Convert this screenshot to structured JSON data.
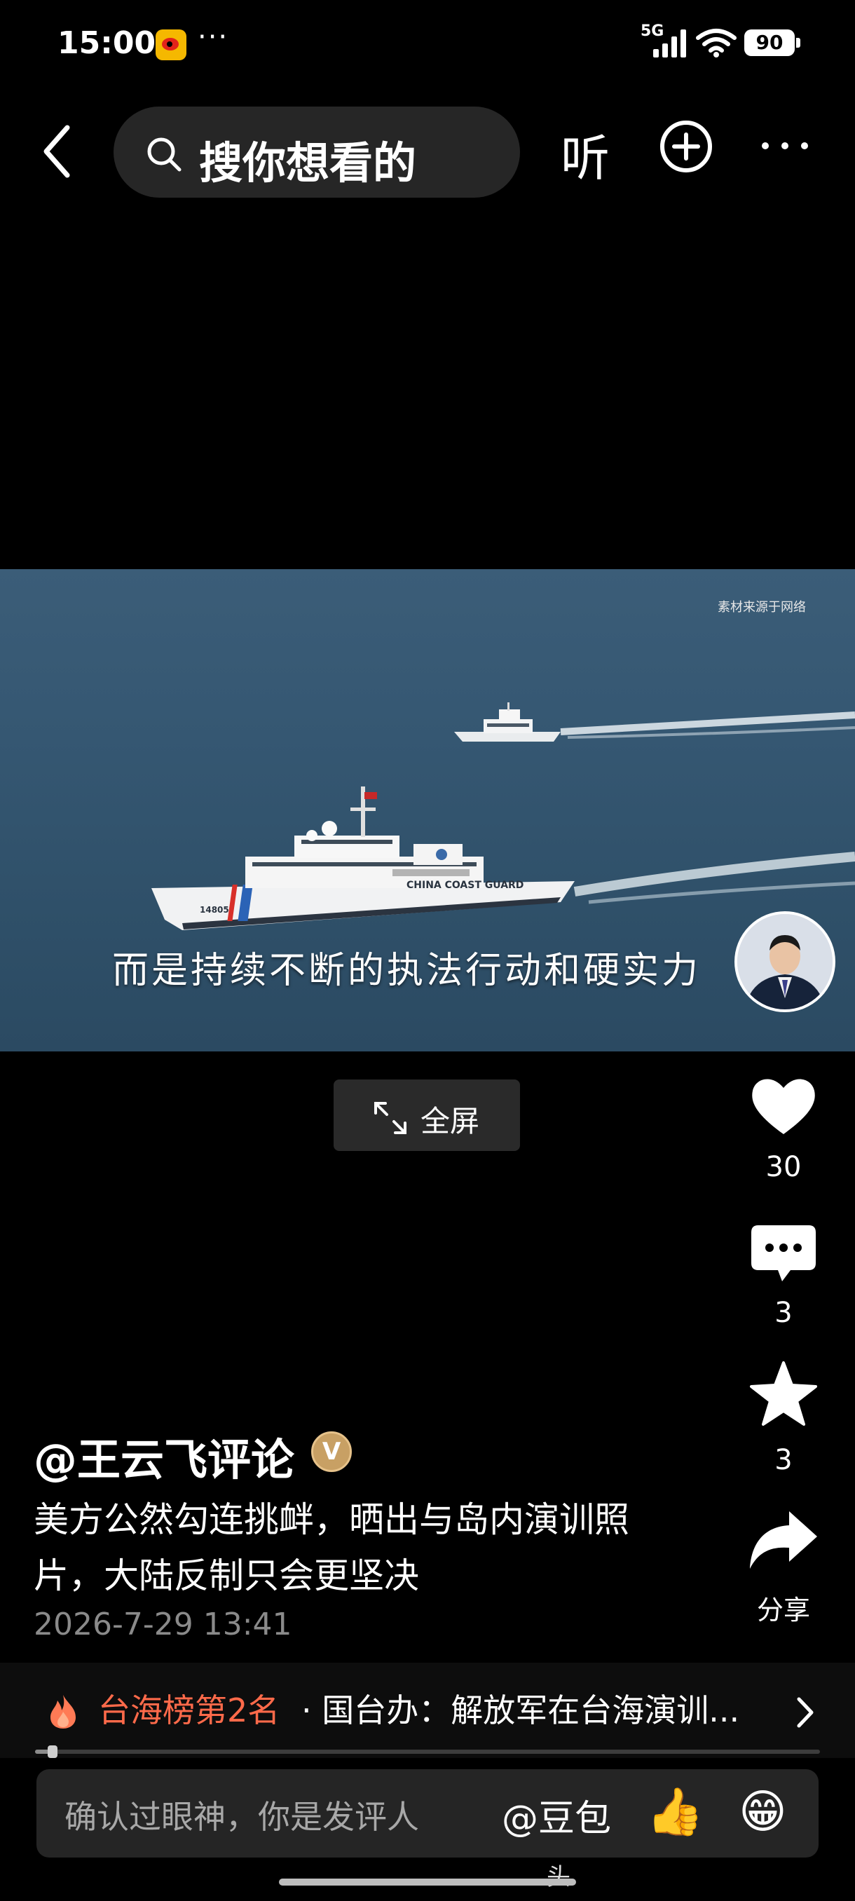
{
  "status_bar": {
    "time": "15:00",
    "more": "···",
    "network": "5G",
    "battery": "90"
  },
  "nav": {
    "search_placeholder": "搜你想看的",
    "listen_label": "听"
  },
  "video": {
    "watermark": "素材来源于网络",
    "subtitle": "而是持续不断的执法行动和硬实力",
    "fullscreen_label": "全屏",
    "progress": 0.02
  },
  "actions": {
    "like_count": "30",
    "comment_count": "3",
    "favorite_count": "3",
    "share_label": "分享"
  },
  "post": {
    "author": "@王云飞评论",
    "verified_badge": "V",
    "caption": "美方公然勾连挑衅，晒出与岛内演训照片，大陆反制只会更坚决",
    "time": "2026-7-29 13:41"
  },
  "trending": {
    "rank_label": "台海榜第2名",
    "topic": "· 国台办：解放军在台海演训..."
  },
  "comment_bar": {
    "placeholder": "确认过眼神，你是发评人",
    "mention": "@豆包",
    "emoji_1": "👍",
    "emoji_2": "😁"
  },
  "bottom_text": "头",
  "colors": {
    "background": "#000000",
    "accent_trending": "#ff6a4a",
    "badge_gold": "#c8a064",
    "weibo_yellow": "#f5b800"
  },
  "icons": [
    "back-arrow-icon",
    "search-icon",
    "add-circle-icon",
    "more-dots-icon",
    "expand-icon",
    "heart-icon",
    "comment-bubble-icon",
    "star-icon",
    "share-arrow-icon",
    "fire-icon",
    "chevron-right-icon"
  ]
}
